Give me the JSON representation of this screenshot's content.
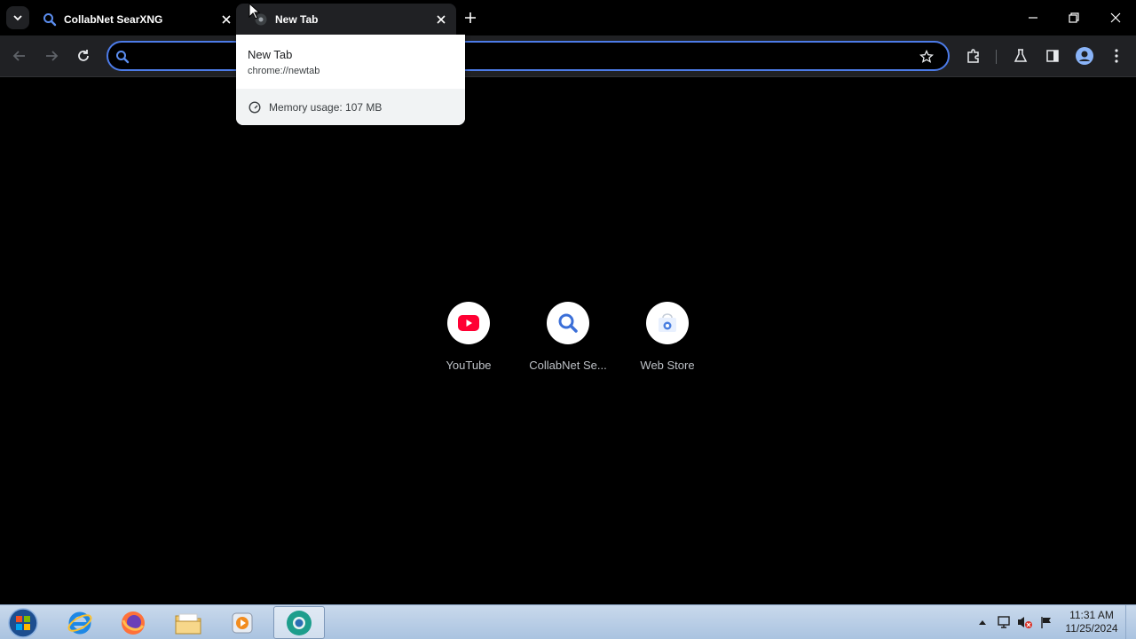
{
  "browser": {
    "tabs": [
      {
        "title": "CollabNet SearXNG",
        "favicon": "search-icon",
        "active": false
      },
      {
        "title": "New Tab",
        "favicon": "chrome-icon",
        "active": true
      }
    ],
    "omnibox": {
      "value": "",
      "placeholder": ""
    }
  },
  "hover_card": {
    "title": "New Tab",
    "url": "chrome://newtab",
    "memory": "Memory usage: 107 MB"
  },
  "shortcuts": [
    {
      "label": "YouTube",
      "icon": "youtube-icon"
    },
    {
      "label": "CollabNet Se...",
      "icon": "search-icon"
    },
    {
      "label": "Web Store",
      "icon": "webstore-icon"
    }
  ],
  "taskbar": {
    "apps": [
      "internet-explorer-icon",
      "firefox-icon",
      "file-explorer-icon",
      "media-player-icon",
      "chrome-app-icon"
    ],
    "time": "11:31 AM",
    "date": "11/25/2024"
  },
  "colors": {
    "accent": "#4c7be8",
    "youtube": "#ff0033",
    "search": "#3b6fd8"
  }
}
